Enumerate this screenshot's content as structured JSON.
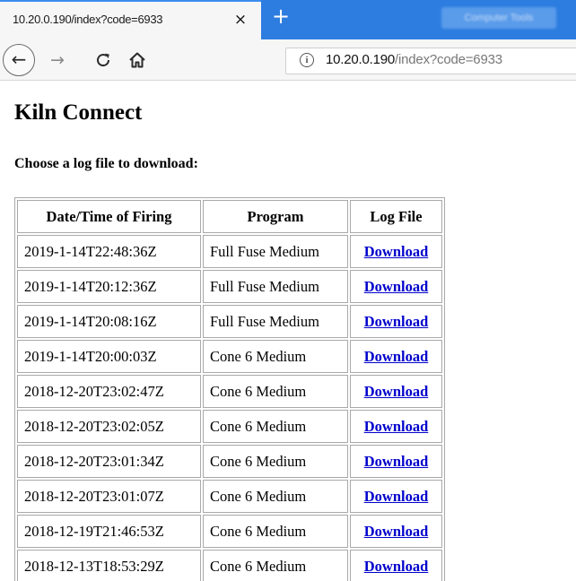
{
  "browser": {
    "tab_title": "10.20.0.190/index?code=6933",
    "tab_close": "×",
    "new_tab": "+",
    "other_tab_title": "Computer Tools",
    "url_host": "10.20.0.190",
    "url_path": "/index?code=6933",
    "icons": {
      "back": "back-arrow-icon",
      "forward": "forward-arrow-icon",
      "reload": "reload-icon",
      "home": "home-icon",
      "info": "info-icon"
    }
  },
  "page": {
    "title": "Kiln Connect",
    "prompt": "Choose a log file to download:",
    "table": {
      "headers": [
        "Date/Time of Firing",
        "Program",
        "Log File"
      ],
      "rows": [
        {
          "datetime": "2019-1-14T22:48:36Z",
          "program": "Full Fuse Medium",
          "link": "Download"
        },
        {
          "datetime": "2019-1-14T20:12:36Z",
          "program": "Full Fuse Medium",
          "link": "Download"
        },
        {
          "datetime": "2019-1-14T20:08:16Z",
          "program": "Full Fuse Medium",
          "link": "Download"
        },
        {
          "datetime": "2019-1-14T20:00:03Z",
          "program": "Cone 6 Medium",
          "link": "Download"
        },
        {
          "datetime": "2018-12-20T23:02:47Z",
          "program": "Cone 6 Medium",
          "link": "Download"
        },
        {
          "datetime": "2018-12-20T23:02:05Z",
          "program": "Cone 6 Medium",
          "link": "Download"
        },
        {
          "datetime": "2018-12-20T23:01:34Z",
          "program": "Cone 6 Medium",
          "link": "Download"
        },
        {
          "datetime": "2018-12-20T23:01:07Z",
          "program": "Cone 6 Medium",
          "link": "Download"
        },
        {
          "datetime": "2018-12-19T21:46:53Z",
          "program": "Cone 6 Medium",
          "link": "Download"
        },
        {
          "datetime": "2018-12-13T18:53:29Z",
          "program": "Cone 6 Medium",
          "link": "Download"
        }
      ]
    }
  },
  "colors": {
    "tabstrip": "#2d7de0",
    "link": "#0000cc"
  }
}
